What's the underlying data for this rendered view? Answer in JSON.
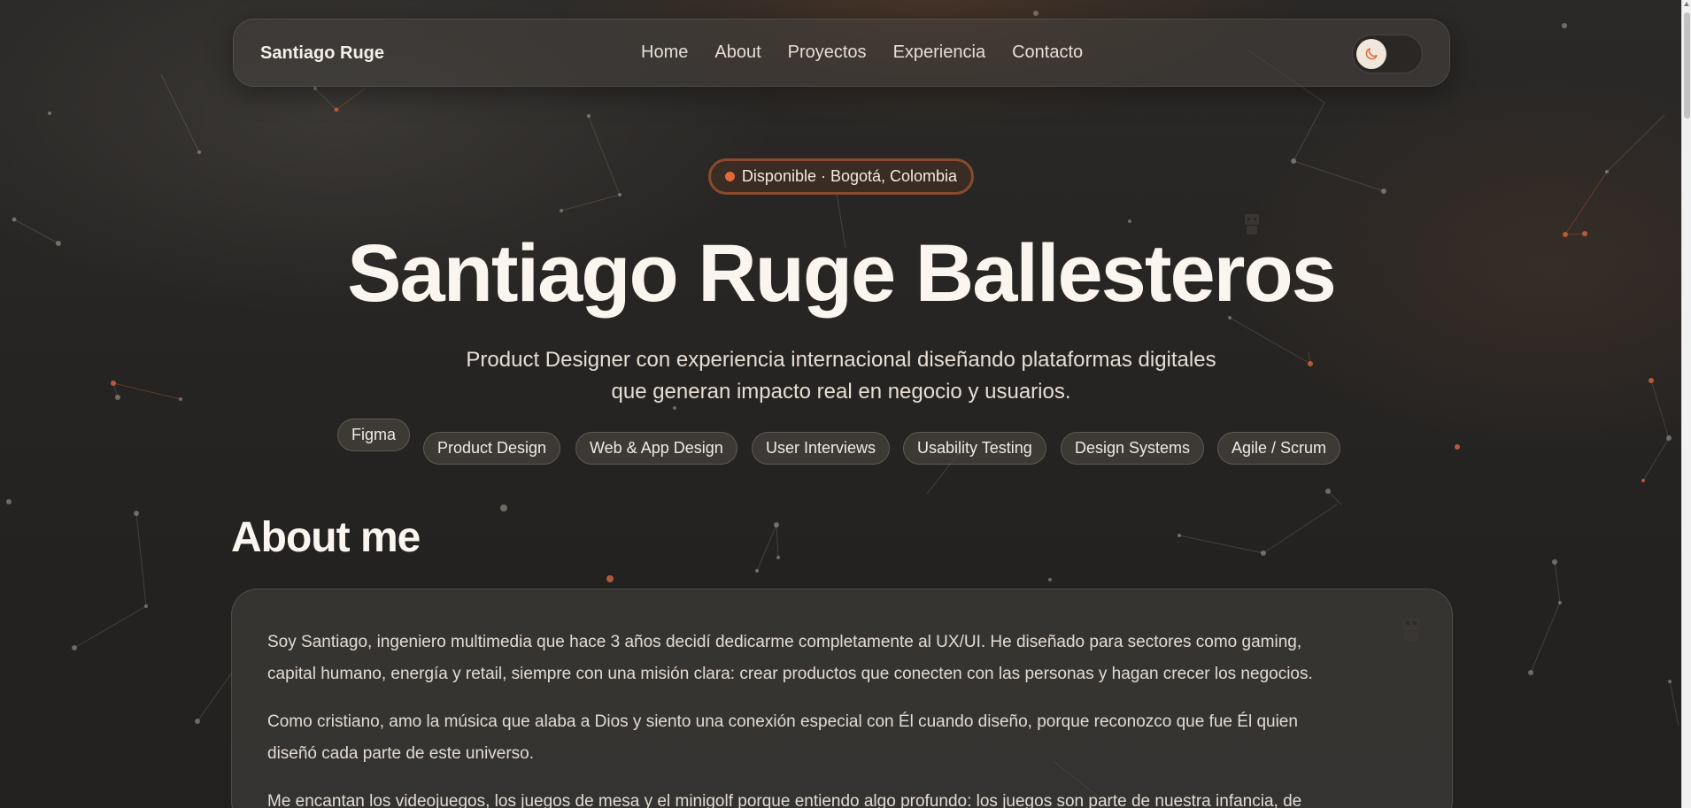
{
  "colors": {
    "background": "#262422",
    "accent": "#e2693a",
    "text": "#f3ede6"
  },
  "navbar": {
    "brand": "Santiago Ruge",
    "links": [
      {
        "label": "Home"
      },
      {
        "label": "About"
      },
      {
        "label": "Proyectos"
      },
      {
        "label": "Experiencia"
      },
      {
        "label": "Contacto"
      }
    ],
    "theme_toggle_icon": "moon-icon"
  },
  "hero": {
    "status": "Disponible · Bogotá, Colombia",
    "title": "Santiago Ruge Ballesteros",
    "subtitle_line1": "Product Designer con experiencia internacional diseñando plataformas digitales",
    "subtitle_line2": "que generan impacto real en negocio y usuarios.",
    "tags": [
      {
        "label": "Figma"
      },
      {
        "label": "Product Design"
      },
      {
        "label": "Web & App Design"
      },
      {
        "label": "User Interviews"
      },
      {
        "label": "Usability Testing"
      },
      {
        "label": "Design Systems"
      },
      {
        "label": "Agile / Scrum"
      }
    ]
  },
  "about": {
    "title": "About me",
    "p1_line1": "Soy Santiago, ingeniero multimedia que hace 3 años decidí dedicarme completamente al UX/UI. He diseñado para sectores como gaming,",
    "p1_line2": "capital humano, energía y retail, siempre con una misión clara: crear productos que conecten con las personas y hagan crecer los negocios.",
    "p2_line1": "Como cristiano, amo la música que alaba a Dios y siento una conexión especial con Él cuando diseño, porque reconozco que fue Él quien",
    "p2_line2": "diseñó cada parte de este universo.",
    "p3_line1": "Me encantan los videojuegos, los juegos de mesa y el minigolf porque entiendo algo profundo: los juegos son parte de nuestra infancia, de"
  }
}
